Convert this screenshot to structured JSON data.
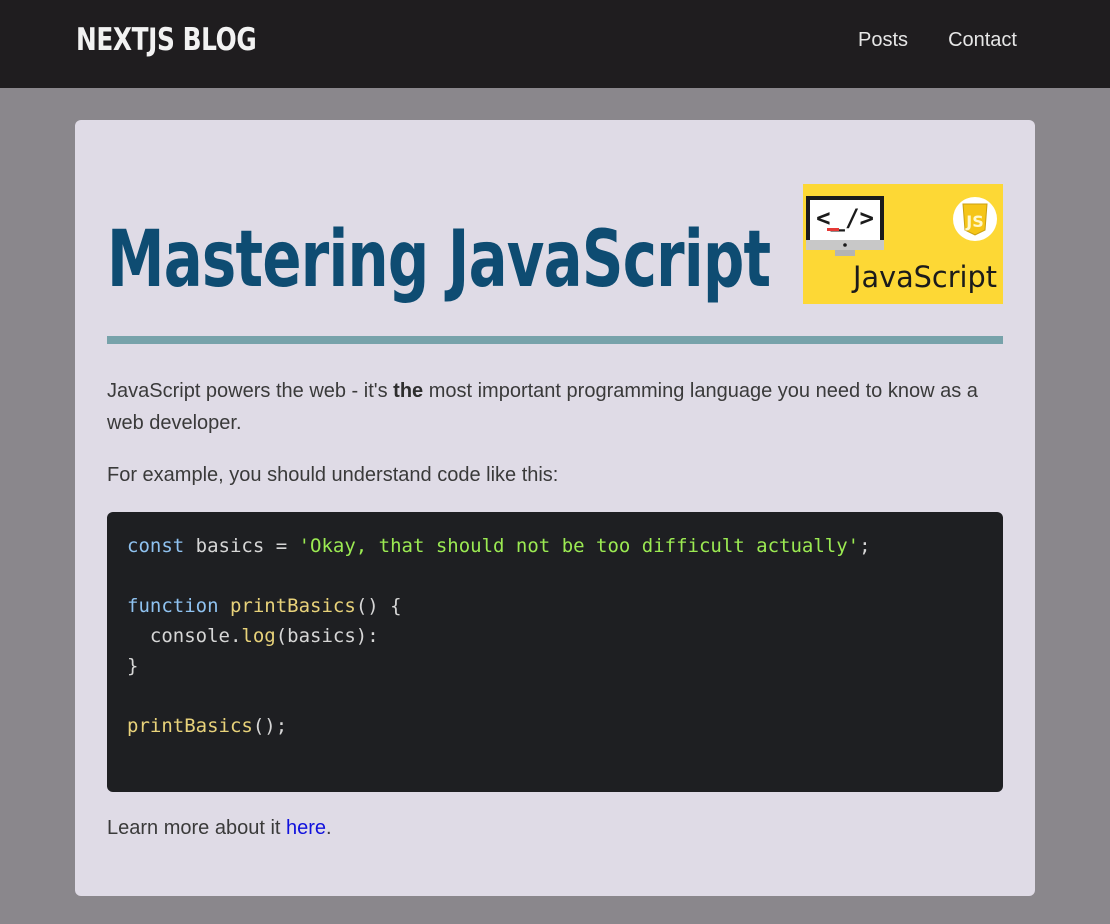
{
  "header": {
    "logo": "NEXTJS BLOG",
    "nav": [
      {
        "label": "Posts"
      },
      {
        "label": "Contact"
      }
    ]
  },
  "post": {
    "title": "Mastering JavaScript",
    "hero_image": {
      "monitor_code_text": "<_/>",
      "badge_text": "JS",
      "caption": "JavaScript"
    },
    "p1": {
      "before": "JavaScript powers the web - it's ",
      "bold": "the",
      "after": " most important programming language you need to know as a web developer."
    },
    "p2": "For example, you should understand code like this:",
    "code": {
      "line1": {
        "kw": "const",
        "rest1": " basics = ",
        "str": "'Okay, that should not be too difficult actually'",
        "rest2": ";"
      },
      "line3": {
        "kw": "function",
        "sp": " ",
        "fn": "printBasics",
        "rest": "() {"
      },
      "line4": {
        "indent": "  console.",
        "fn": "log",
        "rest": "(basics):"
      },
      "line5": "}",
      "line7": {
        "fn": "printBasics",
        "rest": "();"
      }
    },
    "p3": {
      "before": "Learn more about it ",
      "link": "here",
      "after": "."
    }
  },
  "colors": {
    "header_bg": "#1f1d1f",
    "page_bg": "#8a878c",
    "card_bg": "#dfdbe6",
    "title": "#0e4c72",
    "divider": "#77a2aa",
    "code_bg": "#1e1f22",
    "keyword": "#8fc2f0",
    "function": "#e8d27a",
    "string": "#9bea52",
    "link": "#1111dd",
    "hero_bg": "#fdd835"
  }
}
